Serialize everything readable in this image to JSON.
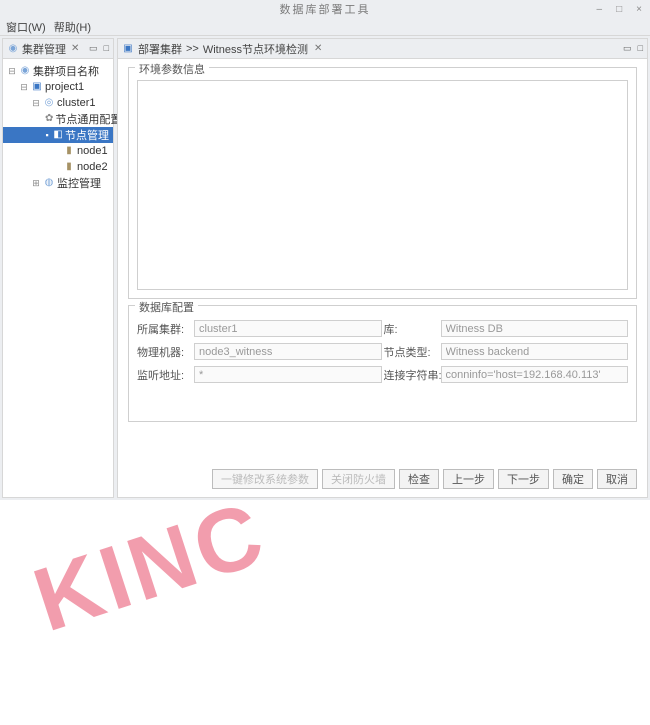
{
  "window": {
    "title": "数据库部署工具",
    "minimize": "–",
    "maximize": "□",
    "close": "×"
  },
  "menu": {
    "window": "窗口(W)",
    "help": "帮助(H)"
  },
  "left_panel": {
    "tab_title": "集群管理",
    "tree": {
      "root": "集群项目名称",
      "project": "project1",
      "cluster": "cluster1",
      "node_common_cfg": "节点通用配置",
      "node_manage": "节点管理",
      "node1": "node1",
      "node2": "node2",
      "monitor_manage": "监控管理"
    }
  },
  "right_panel": {
    "breadcrumb_root": "部署集群",
    "breadcrumb_sep": ">>",
    "breadcrumb_page": "Witness节点环境检测"
  },
  "form": {
    "env_legend": "环境参数信息",
    "db_legend": "数据库配置",
    "labels": {
      "cluster": "所属集群:",
      "db_name": "库:",
      "phys_machine": "物理机器:",
      "node_type": "节点类型:",
      "listen_addr": "监听地址:",
      "conn_str": "连接字符串:"
    },
    "values": {
      "cluster": "cluster1",
      "db_name": "Witness DB",
      "phys_machine": "node3_witness",
      "node_type": "Witness backend",
      "listen_addr": "*",
      "conn_str": "conninfo='host=192.168.40.113'"
    }
  },
  "buttons": {
    "modify_sys": "一键修改系统参数",
    "close_firewall": "关闭防火墙",
    "check": "检查",
    "prev": "上一步",
    "next": "下一步",
    "ok": "确定",
    "cancel": "取消"
  },
  "watermark_text": "KINC"
}
